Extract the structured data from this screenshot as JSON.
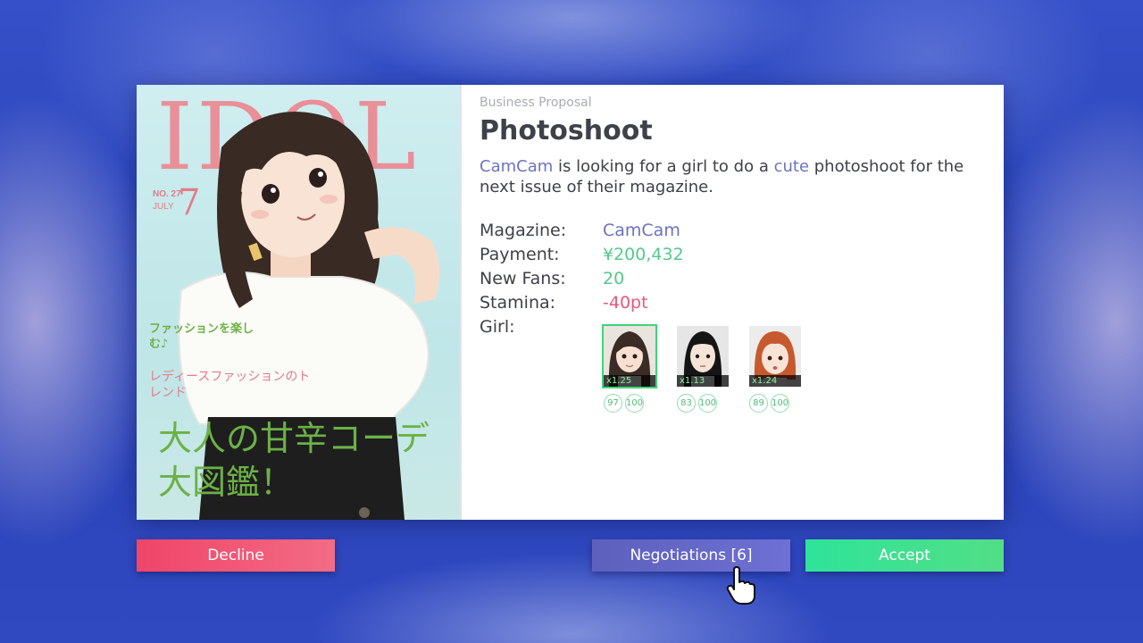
{
  "cover": {
    "title": "IDOL",
    "issue_no": "NO. 27",
    "issue_month": "JULY",
    "issue_num": "7",
    "headline_green": "ファッションを楽しむ♪",
    "headline_pink": "レディースファッションのトレンド",
    "headline_big": "大人の甘辛コーデ大図鑑！"
  },
  "proposal": {
    "eyebrow": "Business Proposal",
    "title": "Photoshoot",
    "desc": {
      "client": "CamCam",
      "part1": " is looking for a girl to do a ",
      "style": "cute",
      "part2": " photoshoot for the next issue of their magazine."
    },
    "stats": {
      "magazine_label": "Magazine:",
      "magazine_value": "CamCam",
      "payment_label": "Payment:",
      "payment_value": "¥200,432",
      "fans_label": "New Fans:",
      "fans_value": "20",
      "stamina_label": "Stamina:",
      "stamina_value": "-40pt",
      "girl_label": "Girl:"
    },
    "girls": [
      {
        "multiplier": "x1.25",
        "stat1": "97",
        "stat2": "100",
        "selected": true
      },
      {
        "multiplier": "x1.13",
        "stat1": "83",
        "stat2": "100",
        "selected": false
      },
      {
        "multiplier": "x1.24",
        "stat1": "89",
        "stat2": "100",
        "selected": false
      }
    ]
  },
  "buttons": {
    "decline": "Decline",
    "negotiations": "Negotiations [6]",
    "accept": "Accept"
  },
  "colors": {
    "accent_purple": "#6b72c2",
    "positive_green": "#53c98a",
    "negative_pink": "#e9577a"
  }
}
